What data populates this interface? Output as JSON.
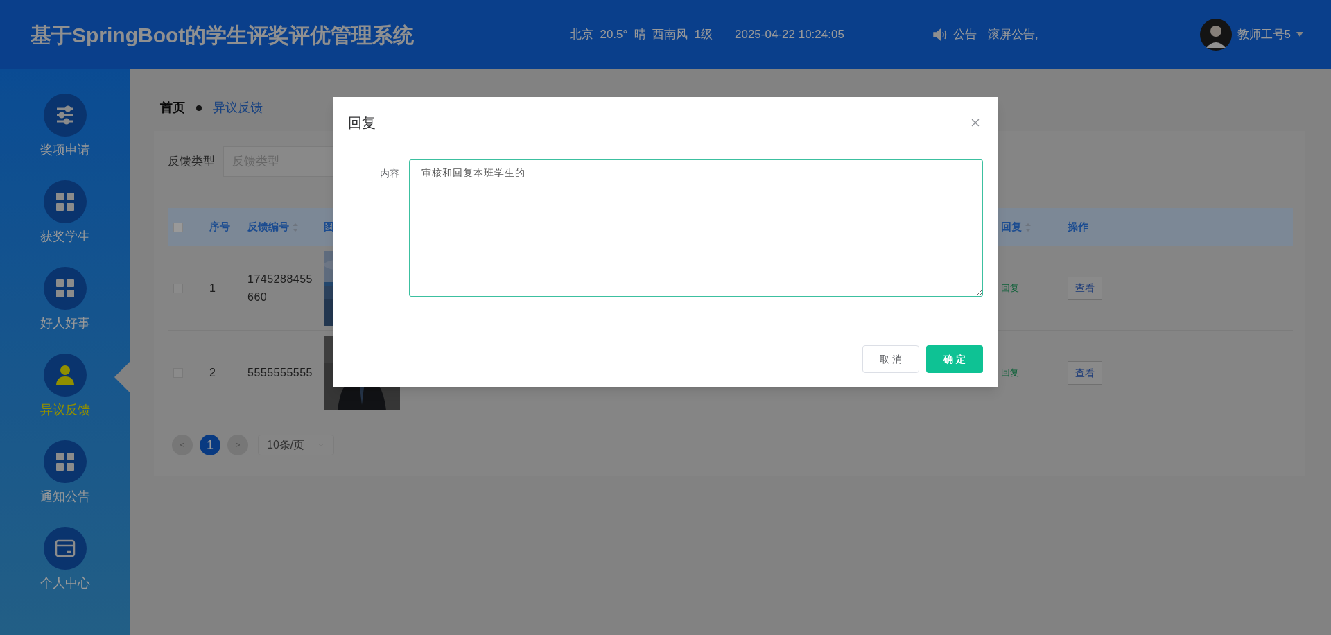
{
  "header": {
    "title": "基于SpringBoot的学生评奖评优管理系统",
    "weather": "北京  20.5°  晴  西南风  1级",
    "datetime": "2025-04-22 10:24:05",
    "notice_label": "公告",
    "notice_text": "滚屏公告,",
    "user": "教师工号5"
  },
  "sidebar": {
    "items": [
      {
        "label": "奖项申请",
        "kind": "sliders",
        "selected": false
      },
      {
        "label": "获奖学生",
        "kind": "grid",
        "selected": false
      },
      {
        "label": "好人好事",
        "kind": "grid",
        "selected": false
      },
      {
        "label": "异议反馈",
        "kind": "person",
        "selected": true
      },
      {
        "label": "通知公告",
        "kind": "grid",
        "selected": false
      },
      {
        "label": "个人中心",
        "kind": "card",
        "selected": false
      }
    ]
  },
  "breadcrumb": [
    "首页",
    "异议反馈"
  ],
  "filter": {
    "label": "反馈类型",
    "placeholder": "反馈类型"
  },
  "table": {
    "select_all": {
      "checked": false
    },
    "columns": [
      {
        "label": "序号",
        "sortable": false
      },
      {
        "label": "反馈编号",
        "sortable": true
      },
      {
        "label": "图",
        "sortable": false
      },
      {
        "label": "回复",
        "sortable": true
      },
      {
        "label": "操作",
        "sortable": false
      }
    ],
    "rows": [
      {
        "checked": false,
        "index": "1",
        "number": "1745288455660",
        "reply": "回复",
        "action": "查看"
      },
      {
        "checked": false,
        "index": "2",
        "number": "5555555555",
        "reply": "回复",
        "action": "查看"
      }
    ]
  },
  "pagination": {
    "prev": "<",
    "pages": [
      {
        "label": "1",
        "selected": true
      }
    ],
    "next": ">",
    "page_size": "10条/页"
  },
  "dialog": {
    "title": "回复",
    "field_label": "内容",
    "value": "审核和回复本班学生的",
    "buttons": [
      {
        "label": "取 消",
        "kind": "default"
      },
      {
        "label": "确 定",
        "kind": "primary"
      }
    ]
  }
}
